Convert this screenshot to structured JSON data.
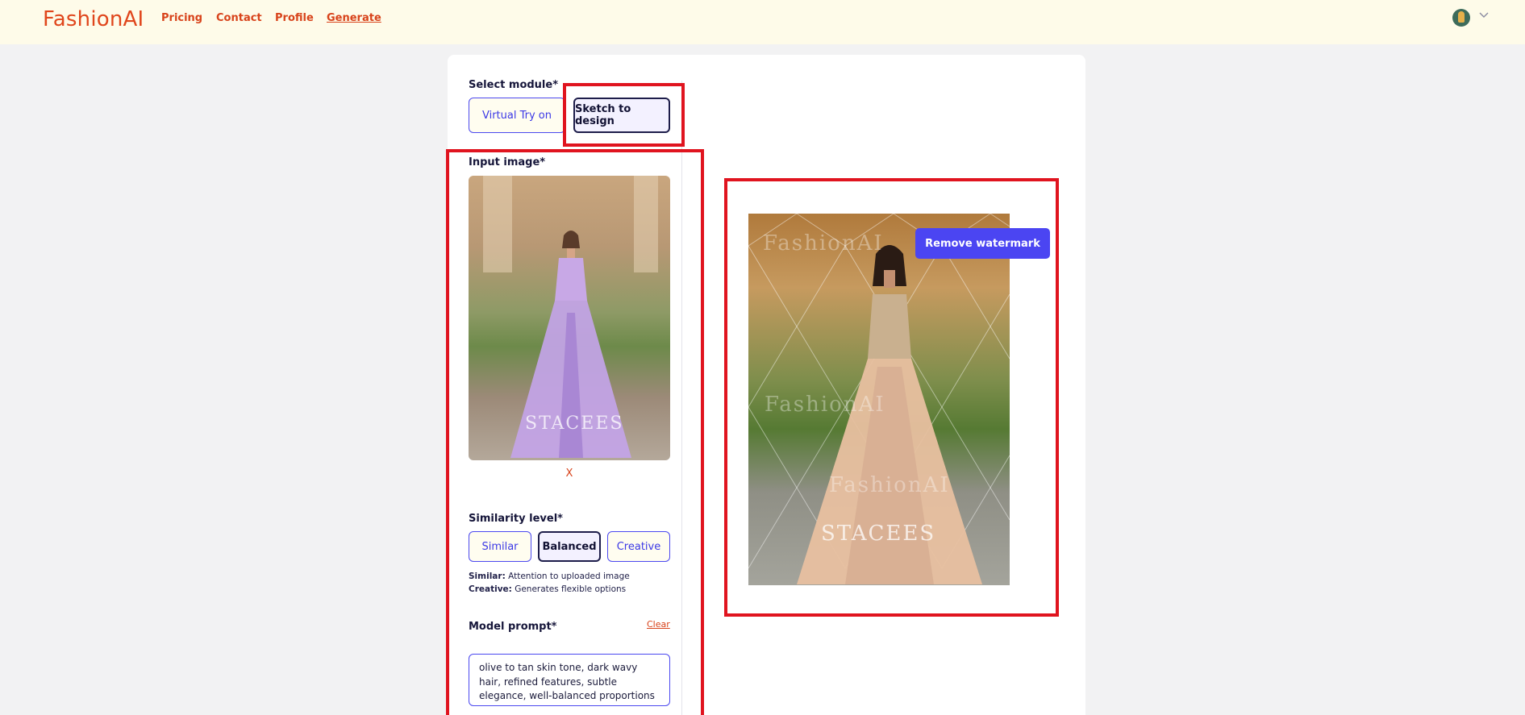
{
  "header": {
    "logo": "FashionAI",
    "nav": [
      {
        "label": "Pricing"
      },
      {
        "label": "Contact"
      },
      {
        "label": "Profile"
      },
      {
        "label": "Generate"
      }
    ]
  },
  "module": {
    "label": "Select module*",
    "options": [
      {
        "label": "Virtual Try on",
        "selected": false
      },
      {
        "label": "Sketch to design",
        "selected": true
      }
    ]
  },
  "input_image": {
    "label": "Input image*",
    "watermark": "STACEES",
    "remove_label": "X"
  },
  "similarity": {
    "label": "Similarity level*",
    "options": [
      {
        "label": "Similar",
        "selected": false
      },
      {
        "label": "Balanced",
        "selected": true
      },
      {
        "label": "Creative",
        "selected": false
      }
    ],
    "hints": [
      {
        "term": "Similar:",
        "text": " Attention to uploaded image"
      },
      {
        "term": "Creative:",
        "text": " Generates flexible options"
      }
    ]
  },
  "model_prompt": {
    "label": "Model prompt*",
    "clear_label": "Clear",
    "value": "olive to tan skin tone, dark wavy hair, refined features, subtle elegance, well-balanced proportions"
  },
  "output": {
    "remove_watermark_label": "Remove watermark",
    "watermarks": [
      "FashionAI",
      "FashionAI",
      "FashionAI",
      "STACEES"
    ]
  },
  "colors": {
    "accent": "#4b45f2",
    "brand": "#e0461c",
    "highlight": "#e0141f",
    "header_bg": "#fefbe9"
  }
}
